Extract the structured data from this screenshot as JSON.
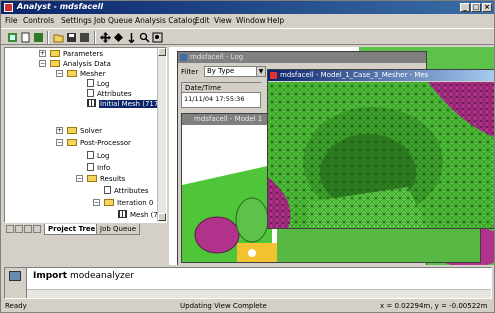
{
  "window": {
    "title": "Analyst - mdsfacell"
  },
  "menu": [
    "File",
    "Controls",
    "Settings",
    "Job Queue",
    "Analysis Catalog",
    "Edit",
    "View",
    "Window",
    "Help"
  ],
  "tree": {
    "parameters": "Parameters",
    "analysis_data": "Analysis Data",
    "mesher": "Mesher",
    "log": "Log",
    "attributes": "Attributes",
    "initial_mesh": "Initial Mesh (717",
    "solver": "Solver",
    "post_processor": "Post-Processor",
    "pp_log": "Log",
    "pp_info": "Info",
    "results": "Results",
    "res_attributes": "Attributes",
    "iteration": "Iteration 0",
    "mesh": "Mesh (7"
  },
  "tabs": {
    "project_tree": "Project Tree",
    "job_queue": "Job Queue"
  },
  "log_window": {
    "title": "mdsfacell - Log",
    "filter_label": "Filter",
    "filter_value": "By Type",
    "col_date": "Date/Time",
    "row1": "11/11/04 17:55:36"
  },
  "model_window": {
    "title": "mdsfacell - Model 1"
  },
  "mesher_window": {
    "title": "mdsfacell - Model_1_Case_3_Mesher - Mes"
  },
  "command": {
    "keyword": "Import",
    "argument": "modeanalyzer"
  },
  "status": {
    "left": "Ready",
    "middle": "Updating View Complete",
    "right": "x = 0.02294m, y = -0.00522m"
  },
  "colors": {
    "mesh_green": "#4fc63a",
    "mesh_magenta": "#b0328a",
    "title_blue": "#0a246a"
  }
}
